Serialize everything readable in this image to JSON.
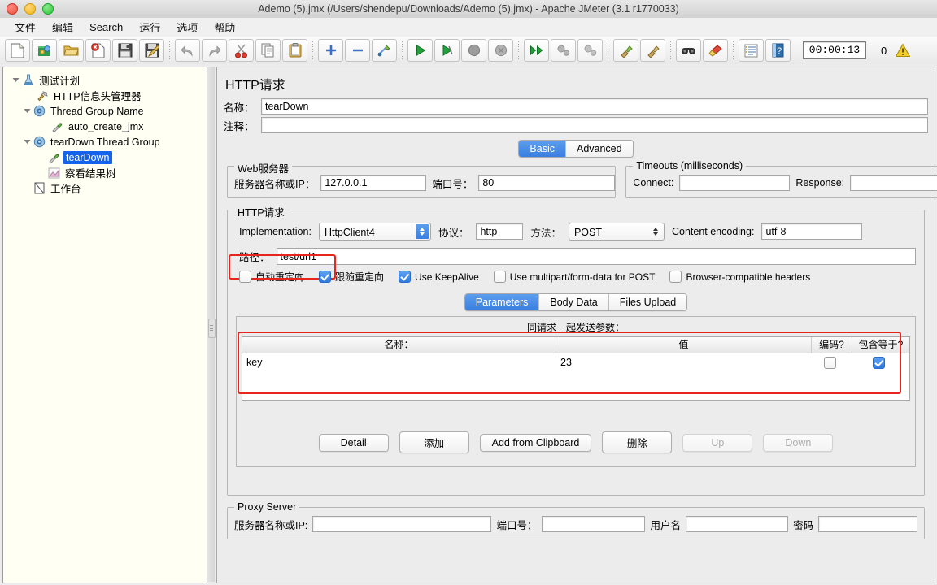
{
  "window": {
    "title": "Ademo (5).jmx (/Users/shendepu/Downloads/Ademo (5).jmx) - Apache JMeter (3.1 r1770033)",
    "traffic": [
      "close-button",
      "minimize-button",
      "zoom-button"
    ]
  },
  "menubar": {
    "items": [
      {
        "label": "文件",
        "name": "menu-file"
      },
      {
        "label": "编辑",
        "name": "menu-edit"
      },
      {
        "label": "Search",
        "name": "menu-search"
      },
      {
        "label": "运行",
        "name": "menu-run"
      },
      {
        "label": "选项",
        "name": "menu-options"
      },
      {
        "label": "帮助",
        "name": "menu-help"
      }
    ]
  },
  "toolbar": {
    "timer": "00:00:13",
    "error_count": "0",
    "buttons": [
      "new-icon",
      "templates-icon",
      "open-icon",
      "close-icon",
      "save-icon",
      "save-as-icon",
      "undo-icon",
      "redo-icon",
      "cut-icon",
      "copy-icon",
      "paste-icon",
      "expand-icon",
      "collapse-icon",
      "toggle-icon",
      "start-icon",
      "start-no-timers-icon",
      "stop-icon",
      "shutdown-icon",
      "start-remote-icon",
      "stop-remote-icon",
      "shutdown-remote-icon",
      "clear-icon",
      "clear-all-icon",
      "search-icon",
      "reset-search-icon",
      "function-helper-icon",
      "help-icon"
    ]
  },
  "tree": {
    "nodes": [
      {
        "label": "测试计划",
        "icon": "test-plan-icon",
        "depth": 0,
        "twist": "down",
        "selected": false
      },
      {
        "label": "HTTP信息头管理器",
        "icon": "header-manager-icon",
        "depth": 1,
        "twist": "none",
        "selected": false
      },
      {
        "label": "Thread Group Name",
        "icon": "thread-group-icon",
        "depth": 1,
        "twist": "down",
        "selected": false
      },
      {
        "label": "auto_create_jmx",
        "icon": "http-sampler-icon",
        "depth": 2,
        "twist": "none",
        "selected": false
      },
      {
        "label": "tearDown Thread Group",
        "icon": "thread-group-icon",
        "depth": 1,
        "twist": "down",
        "selected": false
      },
      {
        "label": "tearDown",
        "icon": "http-sampler-icon",
        "depth": 2,
        "twist": "none",
        "selected": true
      },
      {
        "label": "察看结果树",
        "icon": "view-results-tree-icon",
        "depth": 2,
        "twist": "none",
        "selected": false
      },
      {
        "label": "工作台",
        "icon": "workbench-icon",
        "depth": 0,
        "twist": "none",
        "selected": false
      }
    ]
  },
  "main": {
    "panel_title": "HTTP请求",
    "name_label": "名称：",
    "name_value": "tearDown",
    "comment_label": "注释：",
    "comment_value": "",
    "tabs": [
      {
        "label": "Basic",
        "active": true
      },
      {
        "label": "Advanced",
        "active": false
      }
    ],
    "web_server": {
      "legend": "Web服务器",
      "server_label": "服务器名称或IP：",
      "server_value": "127.0.0.1",
      "port_label": "端口号：",
      "port_value": "80"
    },
    "timeouts": {
      "legend": "Timeouts (milliseconds)",
      "connect_label": "Connect:",
      "connect_value": "",
      "response_label": "Response:",
      "response_value": ""
    },
    "http_request": {
      "legend": "HTTP请求",
      "implementation_label": "Implementation:",
      "implementation_value": "HttpClient4",
      "protocol_label": "协议：",
      "protocol_value": "http",
      "method_label": "方法：",
      "method_value": "POST",
      "encoding_label": "Content encoding:",
      "encoding_value": "utf-8",
      "path_label": "路径：",
      "path_value": "test/url1",
      "checkboxes": [
        {
          "label": "自动重定向",
          "checked": false,
          "name": "auto-redirect-checkbox"
        },
        {
          "label": "跟随重定向",
          "checked": true,
          "name": "follow-redirects-checkbox"
        },
        {
          "label": "Use KeepAlive",
          "checked": true,
          "name": "use-keepalive-checkbox"
        },
        {
          "label": "Use multipart/form-data for POST",
          "checked": false,
          "name": "use-multipart-checkbox"
        },
        {
          "label": "Browser-compatible headers",
          "checked": false,
          "name": "browser-compatible-headers-checkbox"
        }
      ],
      "param_tabs": [
        {
          "label": "Parameters",
          "active": true
        },
        {
          "label": "Body Data",
          "active": false
        },
        {
          "label": "Files Upload",
          "active": false
        }
      ],
      "params_caption": "同请求一起发送参数：",
      "table": {
        "columns": [
          "名称：",
          "值",
          "编码?",
          "包含等于?"
        ],
        "rows": [
          {
            "name": "key",
            "value": "23",
            "encode": false,
            "include_equals": true
          }
        ]
      },
      "buttons": [
        {
          "label": "Detail",
          "disabled": false,
          "name": "detail-button"
        },
        {
          "label": "添加",
          "disabled": false,
          "name": "add-button"
        },
        {
          "label": "Add from Clipboard",
          "disabled": false,
          "name": "add-from-clipboard-button"
        },
        {
          "label": "删除",
          "disabled": false,
          "name": "delete-button"
        },
        {
          "label": "Up",
          "disabled": true,
          "name": "up-button"
        },
        {
          "label": "Down",
          "disabled": true,
          "name": "down-button"
        }
      ]
    },
    "proxy_server": {
      "legend": "Proxy Server",
      "server_label": "服务器名称或IP:",
      "server_value": "",
      "port_label": "端口号：",
      "port_value": "",
      "username_label": "用户名",
      "username_value": "",
      "password_label": "密码",
      "password_value": ""
    }
  },
  "colors": {
    "accent": "#3a7fe0",
    "selection": "#1463ec",
    "highlight_box": "#e8251c",
    "tree_bg": "#fffff4"
  }
}
